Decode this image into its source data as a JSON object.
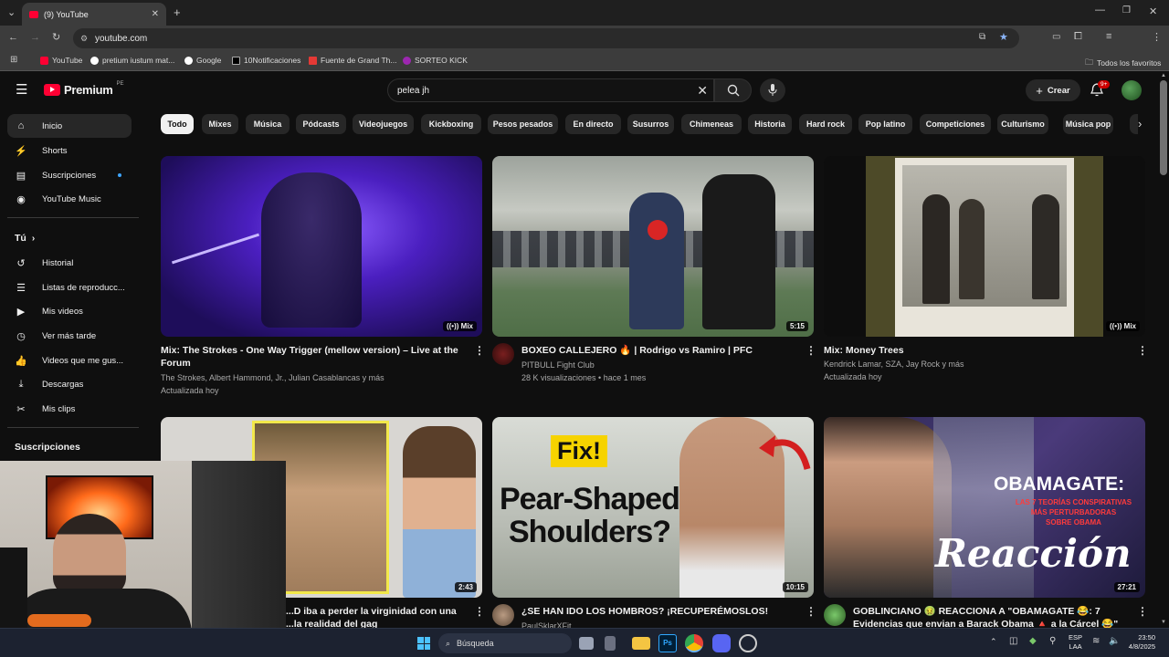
{
  "browser": {
    "tab_title": "(9) YouTube",
    "url": "youtube.com",
    "bookmarks": [
      "YouTube",
      "pretium iustum mat...",
      "Google",
      "10Notificaciones",
      "Fuente de Grand Th...",
      "SORTEO KICK"
    ],
    "all_bookmarks": "Todos los favoritos"
  },
  "masthead": {
    "logo_text": "Premium",
    "region": "PE",
    "search_value": "pelea jh",
    "create_label": "Crear",
    "notifications_badge": "9+"
  },
  "sidebar": {
    "main": [
      {
        "label": "Inicio",
        "icon": "home-icon"
      },
      {
        "label": "Shorts",
        "icon": "shorts-icon"
      },
      {
        "label": "Suscripciones",
        "icon": "subscriptions-icon"
      },
      {
        "label": "YouTube Music",
        "icon": "youtube-music-icon"
      }
    ],
    "you_header": "Tú",
    "you": [
      {
        "label": "Historial",
        "icon": "history-icon"
      },
      {
        "label": "Listas de reproducc...",
        "icon": "playlists-icon"
      },
      {
        "label": "Mis videos",
        "icon": "my-videos-icon"
      },
      {
        "label": "Ver más tarde",
        "icon": "watch-later-icon"
      },
      {
        "label": "Videos que me gus...",
        "icon": "liked-videos-icon"
      },
      {
        "label": "Descargas",
        "icon": "downloads-icon"
      },
      {
        "label": "Mis clips",
        "icon": "clips-icon"
      }
    ],
    "subs_header": "Suscripciones"
  },
  "chips": [
    "Todo",
    "Mixes",
    "Música",
    "Pódcasts",
    "Videojuegos",
    "Kickboxing",
    "Pesos pesados",
    "En directo",
    "Susurros",
    "Chimeneas",
    "Historia",
    "Hard rock",
    "Pop latino",
    "Competiciones",
    "Culturismo",
    "Música pop"
  ],
  "videos": [
    {
      "title1": "Mix: The Strokes - One Way Trigger (mellow version) – Live at the",
      "title2": "Forum",
      "meta1": "The Strokes, Albert Hammond, Jr., Julian Casablancas y más",
      "meta2": "Actualizada hoy",
      "badge": "Mix"
    },
    {
      "title1": "BOXEO CALLEJERO 🔥 | Rodrigo vs Ramiro | PFC",
      "title2": "",
      "meta1": "PITBULL Fight Club",
      "meta2": "28 K visualizaciones • hace 1 mes",
      "badge": "5:15"
    },
    {
      "title1": "Mix: Money Trees",
      "title2": "",
      "meta1": "Kendrick Lamar, SZA, Jay Rock y más",
      "meta2": "Actualizada hoy",
      "badge": "Mix"
    },
    {
      "title1": "...D iba a perder la virginidad con una",
      "title2": "...la realidad del gag",
      "meta1": "",
      "meta2": "",
      "badge": "2:43"
    },
    {
      "title1": "¿SE HAN IDO LOS HOMBROS? ¡RECUPERÉMOSLOS!",
      "title2": "",
      "meta1": "PaulSklarXFit",
      "meta2": "",
      "badge": "10:15"
    },
    {
      "title1": "GOBLINCIANO 🤢 REACCIONA A \"OBAMAGATE 😂: 7",
      "title2": "Evidencias que envian a Barack Obama 🔺 a la Cárcel 😂\"",
      "meta1": "",
      "meta2": "",
      "badge": "27:21"
    }
  ],
  "thumb_text": {
    "fix": "Fix!",
    "pear1": "Pear-Shaped",
    "pear2": "Shoulders?",
    "obama1": "OBAMAGATE:",
    "obama2": "LAS 7 TEORÍAS CONSPIRATIVAS",
    "obama3": "MÁS PERTURBADORAS",
    "obama4": "SOBRE OBAMA",
    "reaccion": "Reacción"
  },
  "taskbar": {
    "search": "Búsqueda",
    "lang1": "ESP",
    "lang2": "LAA",
    "time": "23:50",
    "date": "4/8/2025"
  },
  "colors": {
    "accent_red": "#ff0033",
    "chip_bg": "#272727",
    "page_bg": "#0f0f0f"
  }
}
